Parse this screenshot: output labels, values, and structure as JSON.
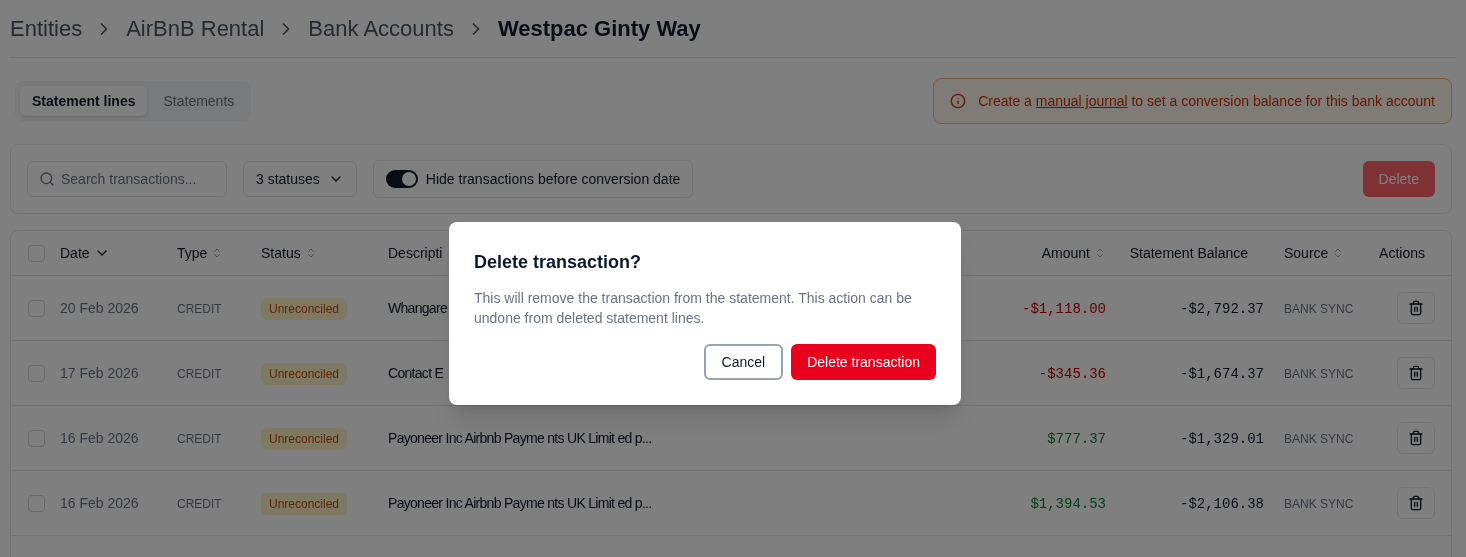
{
  "breadcrumb": [
    {
      "label": "Entities",
      "current": false
    },
    {
      "label": "AirBnB Rental",
      "current": false
    },
    {
      "label": "Bank Accounts",
      "current": false
    },
    {
      "label": "Westpac Ginty Way",
      "current": true
    }
  ],
  "tabs": [
    {
      "label": "Statement lines",
      "selected": true
    },
    {
      "label": "Statements",
      "selected": false
    }
  ],
  "notice": {
    "before": "Create a ",
    "link": "manual journal",
    "after": " to set a conversion balance for this bank account"
  },
  "filters": {
    "search_placeholder": "Search transactions...",
    "status_filter": "3 statuses",
    "toggle": {
      "label": "Hide transactions before conversion date",
      "on": true
    },
    "delete_button": {
      "label": "Delete",
      "disabled": true
    }
  },
  "table": {
    "select_all_checked": false,
    "columns": [
      {
        "label": "Date",
        "sortable": true,
        "sorted": true
      },
      {
        "label": "Type",
        "sortable": true,
        "sorted": false
      },
      {
        "label": "Status",
        "sortable": true,
        "sorted": false
      },
      {
        "label": "Descripti"
      },
      {
        "label": "Amount",
        "sortable": true,
        "sorted": false
      },
      {
        "label": "Statement Balance",
        "sortable": false
      },
      {
        "label": "Source",
        "sortable": true,
        "sorted": false
      },
      {
        "label": "Actions",
        "sortable": false
      }
    ],
    "rows": [
      {
        "checked": false,
        "date": "20 Feb 2026",
        "type": "CREDIT",
        "status": "Unreconciled",
        "description": "Whangare",
        "amount": "-$1,118.00",
        "negative": true,
        "balance": "-$2,792.37",
        "source": "BANK SYNC"
      },
      {
        "checked": false,
        "date": "17 Feb 2026",
        "type": "CREDIT",
        "status": "Unreconciled",
        "description": "Contact E",
        "amount": "-$345.36",
        "negative": true,
        "balance": "-$1,674.37",
        "source": "BANK SYNC"
      },
      {
        "checked": false,
        "date": "16 Feb 2026",
        "type": "CREDIT",
        "status": "Unreconciled",
        "description": "Payoneer Inc Airbnb Payme nts UK Limit ed p...",
        "amount": "$777.37",
        "negative": false,
        "balance": "-$1,329.01",
        "source": "BANK SYNC"
      },
      {
        "checked": false,
        "date": "16 Feb 2026",
        "type": "CREDIT",
        "status": "Unreconciled",
        "description": "Payoneer Inc Airbnb Payme nts UK Limit ed p...",
        "amount": "$1,394.53",
        "negative": false,
        "balance": "-$2,106.38",
        "source": "BANK SYNC"
      }
    ]
  },
  "dialog": {
    "title": "Delete transaction?",
    "message": "This will remove the transaction from the statement. This action can be undone from deleted statement lines.",
    "cancel": "Cancel",
    "confirm": "Delete transaction"
  }
}
